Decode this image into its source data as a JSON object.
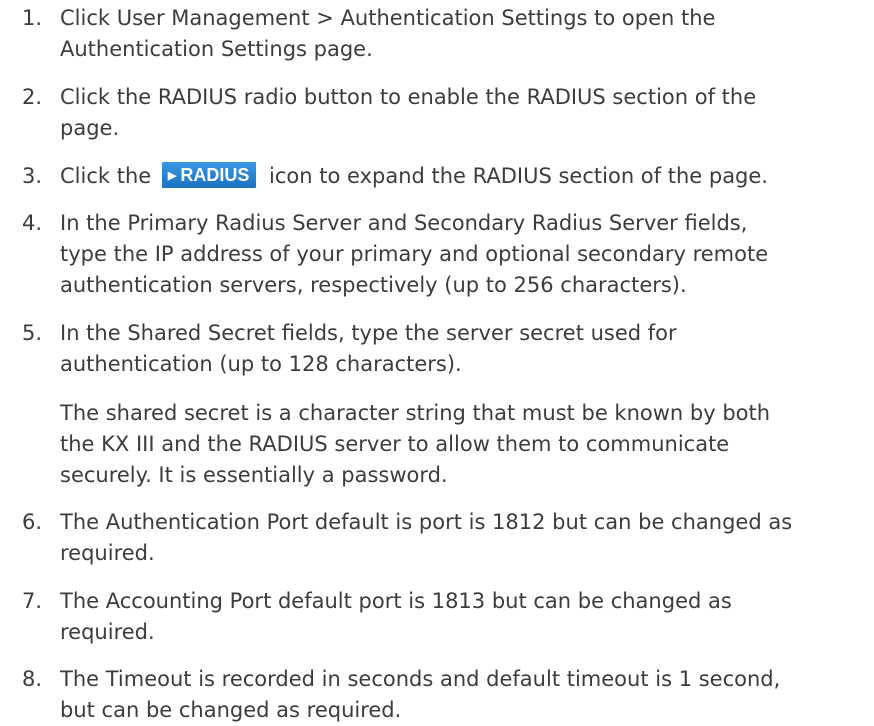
{
  "steps": [
    {
      "number": "1.",
      "lines": [
        "Click User Management > Authentication Settings to open the",
        "Authentication Settings page."
      ]
    },
    {
      "number": "2.",
      "lines": [
        "Click the RADIUS radio button to enable the RADIUS section of the",
        "page."
      ]
    },
    {
      "number": "3.",
      "prefix": "Click the",
      "button_label": "RADIUS",
      "suffix": "icon to expand the RADIUS section of the page."
    },
    {
      "number": "4.",
      "lines": [
        "In the Primary Radius Server and Secondary Radius Server fields,",
        "type the IP address of your primary and optional secondary remote",
        "authentication servers, respectively (up to 256 characters)."
      ]
    },
    {
      "number": "5.",
      "lines": [
        "In the Shared Secret fields, type the server secret used for",
        "authentication (up to 128 characters)."
      ]
    },
    {
      "number": "6.",
      "lines": [
        "The Authentication Port default is port is 1812 but can be changed as",
        "required."
      ]
    },
    {
      "number": "7.",
      "lines": [
        "The Accounting Port default port is 1813 but can be changed as",
        "required."
      ]
    },
    {
      "number": "8.",
      "lines": [
        "The Timeout is recorded in seconds and default timeout is 1 second,",
        "but can be changed as required."
      ]
    }
  ],
  "note": {
    "lines": [
      "The shared secret is a character string that must be known by both",
      "the KX III and the RADIUS server to allow them to communicate",
      "securely. It is essentially a password."
    ]
  },
  "icons": {
    "radius_button_icon": "play-triangle-icon",
    "radius_button_color": "#1f7fd0"
  }
}
